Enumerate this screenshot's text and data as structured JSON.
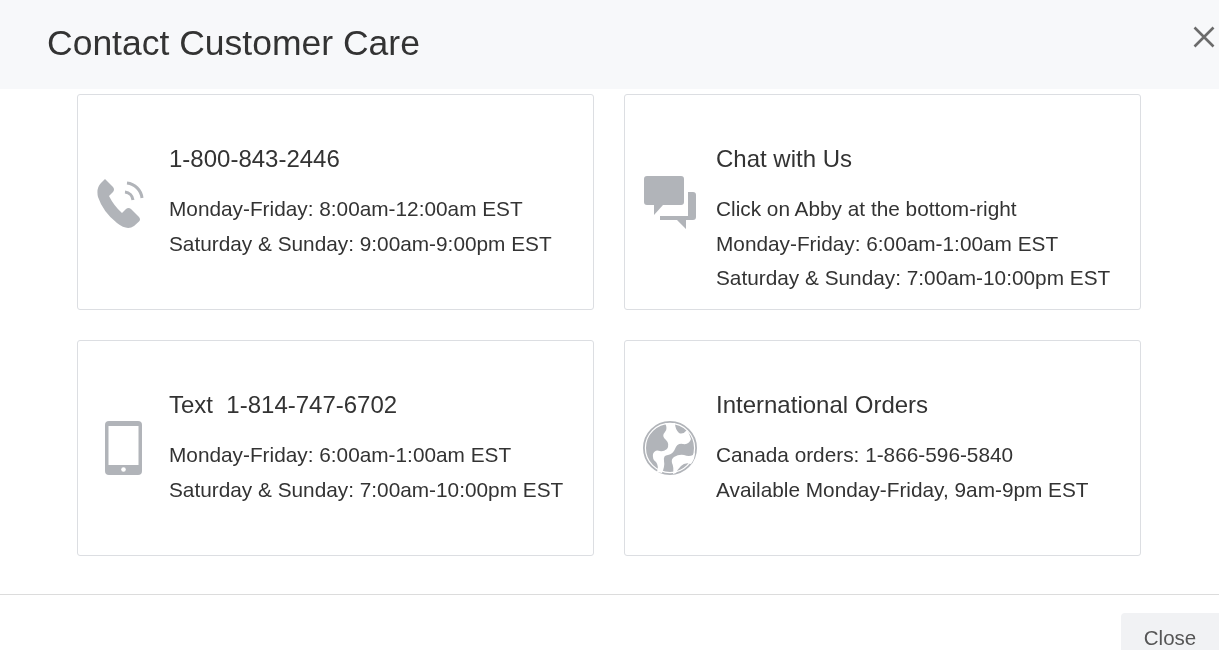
{
  "header": {
    "title": "Contact Customer Care"
  },
  "cards": [
    {
      "kind": "phone",
      "title": "1-800-843-2446",
      "lines": [
        "Monday-Friday: 8:00am-12:00am EST",
        "Saturday & Sunday: 9:00am-9:00pm EST"
      ]
    },
    {
      "kind": "chat",
      "title": "Chat with Us",
      "lines": [
        "Click on Abby at the bottom-right",
        "Monday-Friday: 6:00am-1:00am EST",
        "Saturday & Sunday: 7:00am-10:00pm EST"
      ]
    },
    {
      "kind": "mobile",
      "title": "Text  1-814-747-6702",
      "lines": [
        "Monday-Friday: 6:00am-1:00am EST",
        "Saturday & Sunday: 7:00am-10:00pm EST"
      ]
    },
    {
      "kind": "globe",
      "title": "International Orders",
      "lines": [
        "Canada orders: 1-866-596-5840",
        "Available Monday-Friday, 9am-9pm EST"
      ]
    }
  ],
  "footer": {
    "buttons": [
      "Close"
    ]
  }
}
